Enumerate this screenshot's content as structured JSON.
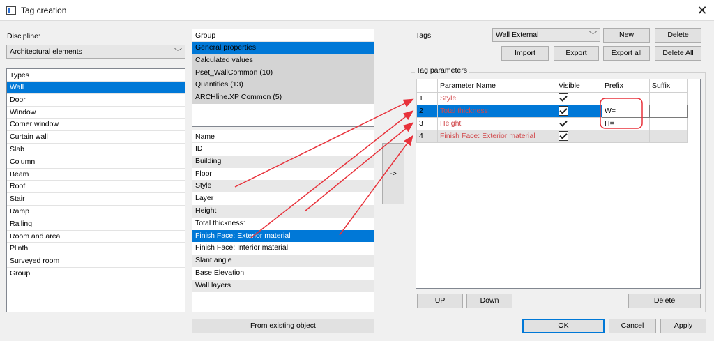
{
  "window": {
    "title": "Tag creation"
  },
  "discipline": {
    "label": "Discipline:",
    "value": "Architectural elements"
  },
  "types": {
    "header": "Types",
    "items": [
      "Wall",
      "Door",
      "Window",
      "Corner window",
      "Curtain wall",
      "Slab",
      "Column",
      "Beam",
      "Roof",
      "Stair",
      "Ramp",
      "Railing",
      "Room and area",
      "Plinth",
      "Surveyed room",
      "Group"
    ],
    "selected_index": 0
  },
  "group": {
    "header": "Group",
    "items": [
      "General properties",
      "Calculated values",
      "Pset_WallCommon (10)",
      "Quantities (13)",
      "ARCHline.XP Common (5)"
    ],
    "selected_index": 0
  },
  "names": {
    "header": "Name",
    "items": [
      "ID",
      "Building",
      "Floor",
      "Style",
      "Layer",
      "Height",
      "Total thickness:",
      "Finish Face: Exterior material",
      "Finish Face: Interior material",
      "Slant angle",
      "Base Elevation",
      "Wall layers"
    ],
    "selected_index": 7
  },
  "add_button": {
    "label": "->"
  },
  "from_existing_button": {
    "label": "From existing object"
  },
  "tags": {
    "label": "Tags",
    "selected": "Wall External",
    "new_label": "New",
    "delete_label": "Delete",
    "import_label": "Import",
    "export_label": "Export",
    "export_all_label": "Export all",
    "delete_all_label": "Delete All"
  },
  "tag_params": {
    "title": "Tag parameters",
    "columns": [
      "Parameter Name",
      "Visible",
      "Prefix",
      "Suffix"
    ],
    "rows": [
      {
        "num": "1",
        "name": "Style",
        "visible": true,
        "prefix": "",
        "suffix": ""
      },
      {
        "num": "2",
        "name": "Total thickness:",
        "visible": true,
        "prefix": "W=",
        "suffix": ""
      },
      {
        "num": "3",
        "name": "Height",
        "visible": true,
        "prefix": "H=",
        "suffix": ""
      },
      {
        "num": "4",
        "name": "Finish Face: Exterior material",
        "visible": true,
        "prefix": "",
        "suffix": ""
      }
    ],
    "up_label": "UP",
    "down_label": "Down",
    "delete_label": "Delete"
  },
  "footer": {
    "ok_label": "OK",
    "cancel_label": "Cancel",
    "apply_label": "Apply"
  },
  "colors": {
    "selection": "#0078d7",
    "annotation_red": "#e8323b",
    "param_text": "#d1484b"
  }
}
